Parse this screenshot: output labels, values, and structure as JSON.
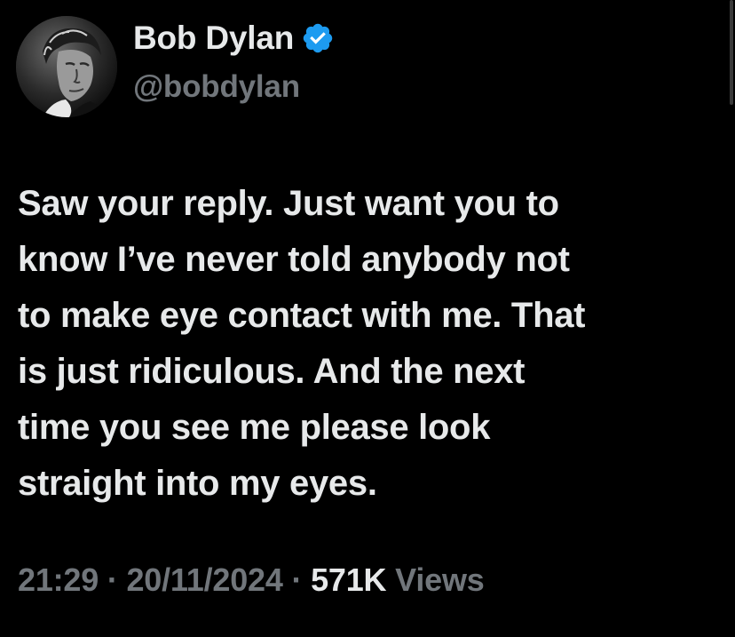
{
  "tweet": {
    "author": {
      "display_name": "Bob Dylan",
      "handle": "@bobdylan",
      "verified": true,
      "verified_icon": "verified-badge-icon",
      "avatar": "profile-photo"
    },
    "text_lines": [
      "Saw your reply. Just want you to",
      "know I’ve never told anybody not",
      "to make eye contact with me. That",
      "is just ridiculous. And the next",
      "time you see me please look",
      "straight into my eyes."
    ],
    "meta": {
      "time": "21:29",
      "separator": " · ",
      "date": "20/11/2024",
      "views_count": "571K",
      "views_label": " Views"
    }
  },
  "colors": {
    "background": "#000000",
    "text_primary": "#e7e9ea",
    "text_secondary": "#71767b",
    "verified_blue": "#1d9bf0"
  }
}
